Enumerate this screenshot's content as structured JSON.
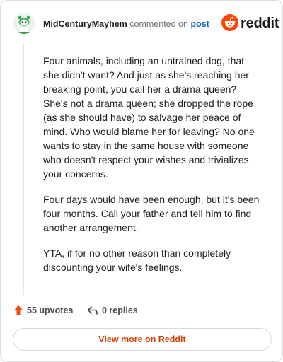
{
  "header": {
    "username": "MidCenturyMayhem",
    "action_text": "commented on",
    "post_link": "post",
    "brand": "reddit"
  },
  "comment": {
    "paragraphs": [
      "Four animals, including an untrained dog, that she didn't want? And just as she's reaching her breaking point, you call her a drama queen? She's not a drama queen; she dropped the rope (as she should have) to salvage her peace of mind. Who would blame her for leaving? No one wants to stay in the same house with someone who doesn't respect your wishes and trivializes your concerns.",
      "Four days would have been enough, but it's been four months. Call your father and tell him to find another arrangement.",
      "YTA, if for no other reason than completely discounting your wife's feelings."
    ]
  },
  "actions": {
    "upvotes": "55 upvotes",
    "replies": "0 replies"
  },
  "footer": {
    "view_more": "View more on Reddit"
  },
  "colors": {
    "brand_orange": "#ff4500",
    "link_blue": "#0a66c2",
    "cta_text": "#d93a00"
  },
  "icons": {
    "avatar": "snoo-avatar-icon",
    "logo": "reddit-snoo-icon",
    "upvote": "upvote-arrow-icon",
    "reply": "reply-arrow-icon"
  }
}
